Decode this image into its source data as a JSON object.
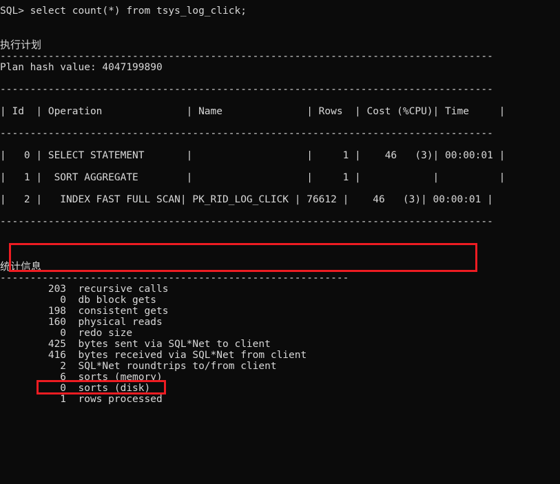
{
  "terminal": {
    "prompt_line": "SQL> select count(*) from tsys_log_click;",
    "blank": "",
    "plan_heading": "执行计划",
    "plan_separator_top": "----------------------------------------------------------------------------------",
    "plan_hash_line": "Plan hash value: 4047199890",
    "plan_separator_mid1": "----------------------------------------------------------------------------------",
    "plan_header_row": "| Id  | Operation              | Name              | Rows  | Cost (%CPU)| Time     |",
    "plan_separator_mid2": "----------------------------------------------------------------------------------",
    "plan_row_0": "|   0 | SELECT STATEMENT       |                   |     1 |    46   (3)| 00:00:01 |",
    "plan_row_1": "|   1 |  SORT AGGREGATE        |                   |     1 |            |          |",
    "plan_row_2": "|   2 |   INDEX FAST FULL SCAN| PK_RID_LOG_CLICK | 76612 |    46   (3)| 00:00:01 |",
    "plan_separator_bottom": "----------------------------------------------------------------------------------",
    "stats_heading": "统计信息",
    "stats_separator": "----------------------------------------------------------",
    "stats_rows": [
      {
        "value": "203",
        "label": "recursive calls"
      },
      {
        "value": "0",
        "label": "db block gets"
      },
      {
        "value": "198",
        "label": "consistent gets"
      },
      {
        "value": "160",
        "label": "physical reads"
      },
      {
        "value": "0",
        "label": "redo size"
      },
      {
        "value": "425",
        "label": "bytes sent via SQL*Net to client"
      },
      {
        "value": "416",
        "label": "bytes received via SQL*Net from client"
      },
      {
        "value": "2",
        "label": "SQL*Net roundtrips to/from client"
      },
      {
        "value": "6",
        "label": "sorts (memory)"
      },
      {
        "value": "0",
        "label": "sorts (disk)"
      },
      {
        "value": "1",
        "label": "rows processed"
      }
    ],
    "plan_table": {
      "columns": [
        "Id",
        "Operation",
        "Name",
        "Rows",
        "Cost (%CPU)",
        "Time"
      ],
      "rows": [
        {
          "id": "0",
          "operation": "SELECT STATEMENT",
          "name": "",
          "rows": "1",
          "cost": "46   (3)",
          "time": "00:00:01"
        },
        {
          "id": "1",
          "operation": "SORT AGGREGATE",
          "name": "",
          "rows": "1",
          "cost": "",
          "time": ""
        },
        {
          "id": "2",
          "operation": "INDEX FAST FULL SCAN",
          "name": "PK_RID_LOG_CLICK",
          "rows": "76612",
          "cost": "46   (3)",
          "time": "00:00:01"
        }
      ]
    },
    "highlight_color": "#ee1c22",
    "background_color": "#0b0b0b",
    "text_color": "#d8d8d8"
  }
}
